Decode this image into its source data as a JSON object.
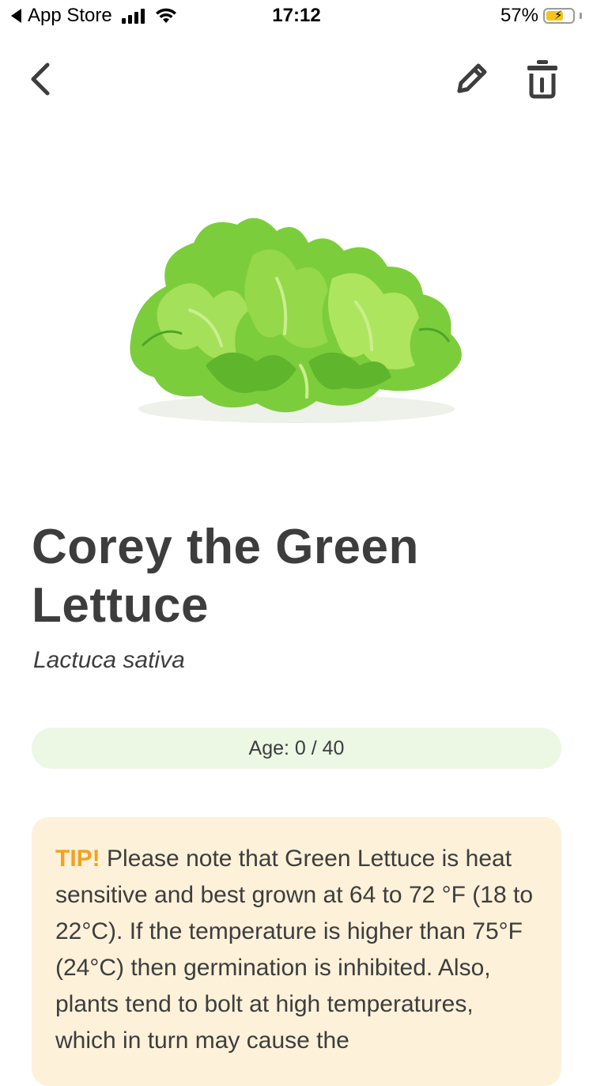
{
  "status_bar": {
    "back_app": "App Store",
    "time": "17:12",
    "battery": "57%",
    "battery_level": 0.57
  },
  "nav": {
    "back_icon": "chevron-left-icon",
    "edit_icon": "pencil-icon",
    "delete_icon": "trash-icon"
  },
  "plant": {
    "name": "Corey the Green Lettuce",
    "scientific_name": "Lactuca sativa",
    "image": "lettuce-image"
  },
  "age": {
    "label": "Age: 0 / 40",
    "current": 0,
    "total": 40
  },
  "tip": {
    "label": "TIP!",
    "text": "Please note that Green Lettuce is heat sensitive and best grown at 64 to 72 °F (18 to 22°C). If the temperature is higher than 75°F (24°C) then germination is inhibited. Also, plants tend to bolt at high temperatures, which in turn may cause the"
  },
  "colors": {
    "text": "#3d3d3d",
    "age_bar_bg": "#ecf7e4",
    "tip_bg": "#fdf1d9",
    "tip_accent": "#f2a21b",
    "battery": "#f5c518"
  }
}
